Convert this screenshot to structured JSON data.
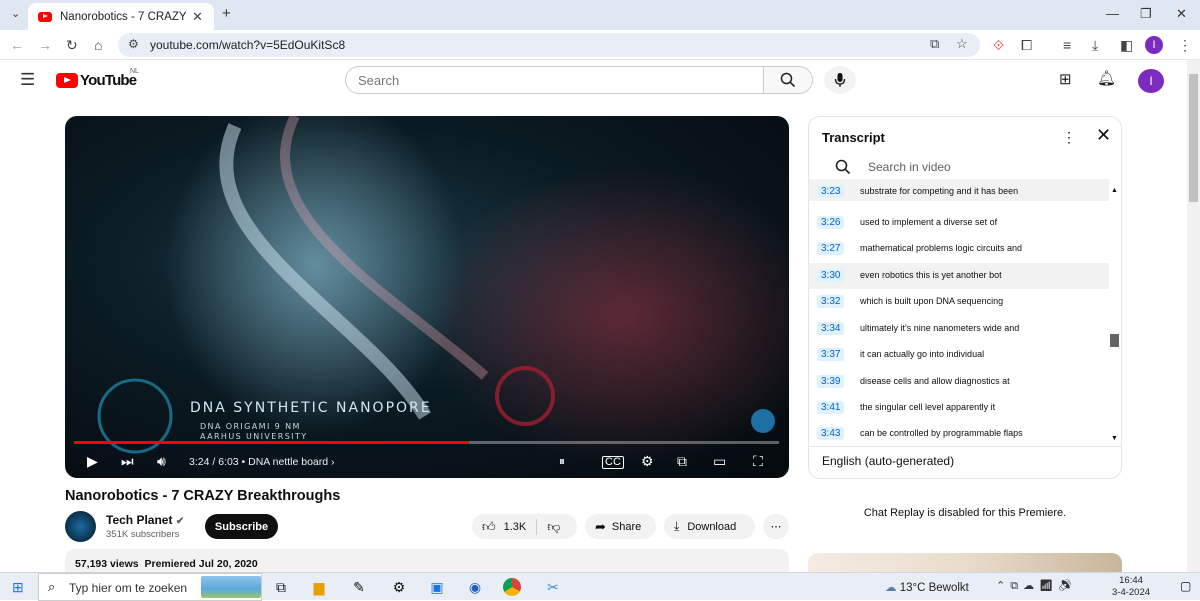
{
  "browser": {
    "tab_title": "Nanorobotics - 7 CRAZY Breakthroughs",
    "url": "youtube.com/watch?v=5EdOuKitSc8",
    "profile_initial": "I"
  },
  "masthead": {
    "logo_text": "YouTube",
    "country_code": "NL",
    "search_placeholder": "Search",
    "avatar_initial": "I"
  },
  "player": {
    "overlay_title": "DNA SYNTHETIC NANOPORE",
    "overlay_sub1": "DNA ORIGAMI 9 NM",
    "overlay_sub2": "AARHUS UNIVERSITY",
    "time_current": "3:24",
    "time_total": "6:03",
    "time_display": "3:24 / 6:03",
    "chapter": "DNA nettle board",
    "played_fraction": 0.56,
    "buffered_fraction": 0.56
  },
  "video": {
    "title": "Nanorobotics - 7 CRAZY Breakthroughs",
    "channel_name": "Tech Planet",
    "subscribers": "351K subscribers",
    "subscribe_label": "Subscribe",
    "likes": "1.3K",
    "share_label": "Share",
    "download_label": "Download",
    "views": "57,193 views",
    "premiered": "Premiered Jul 20, 2020"
  },
  "transcript": {
    "title": "Transcript",
    "search_placeholder": "Search in video",
    "language": "English (auto-generated)",
    "rows": [
      {
        "ts": "3:23",
        "text": "substrate for competing and it has been"
      },
      {
        "ts": "3:26",
        "text": "used to implement a diverse set of"
      },
      {
        "ts": "3:27",
        "text": "mathematical problems logic circuits and"
      },
      {
        "ts": "3:30",
        "text": "even robotics this is yet another bot"
      },
      {
        "ts": "3:32",
        "text": "which is built upon DNA sequencing"
      },
      {
        "ts": "3:34",
        "text": "ultimately it's nine nanometers wide and"
      },
      {
        "ts": "3:37",
        "text": "it can actually go into individual"
      },
      {
        "ts": "3:39",
        "text": "disease cells and allow diagnostics at"
      },
      {
        "ts": "3:41",
        "text": "the singular cell level apparently it"
      },
      {
        "ts": "3:43",
        "text": "can be controlled by programmable flaps"
      }
    ]
  },
  "chat_note": "Chat Replay is disabled for this Premiere.",
  "taskbar": {
    "search_placeholder": "Typ hier om te zoeken",
    "weather": "13°C Bewolkt",
    "time": "16:44",
    "date": "3-4-2024"
  }
}
